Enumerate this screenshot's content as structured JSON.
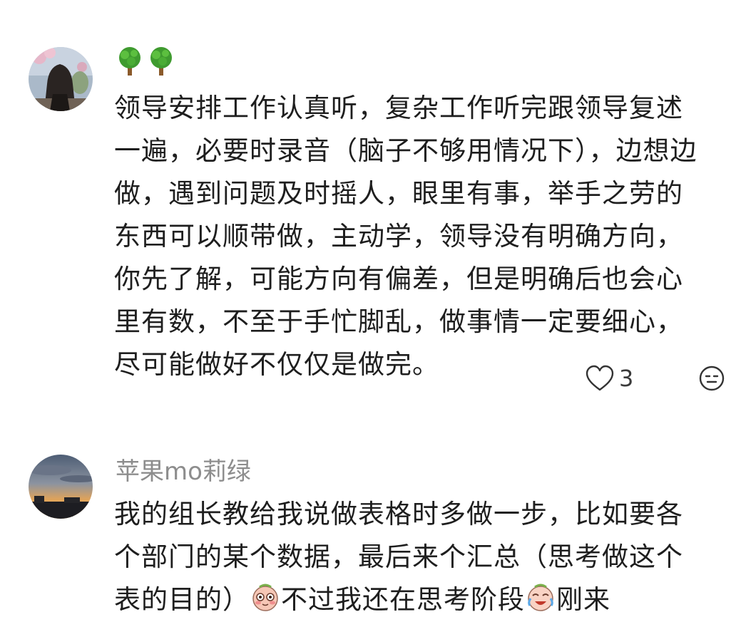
{
  "comments": [
    {
      "username_emoji": [
        "tree-icon",
        "tree-icon"
      ],
      "text": "领导安排工作认真听，复杂工作听完跟领导复述一遍，必要时录音（脑子不够用情况下），边想边做，遇到问题及时摇人，眼里有事，举手之劳的东西可以顺带做，主动学，领导没有明确方向，你先了解，可能方向有偏差，但是明确后也会心里有数，不至于手忙脚乱，做事情一定要细心，尽可能做好不仅仅是做完。",
      "like_count": "3"
    },
    {
      "username": "苹果mo莉绿",
      "text_part1": "我的组长教给我说做表格时多做一步，比如要各个部门的某个数据，最后来个汇总（思考做这个表的目的）",
      "emoji_1": "shy-face-icon",
      "text_part2": "不过我还在思考阶段",
      "emoji_2": "crying-laugh-icon",
      "text_part3": "刚来"
    }
  ]
}
